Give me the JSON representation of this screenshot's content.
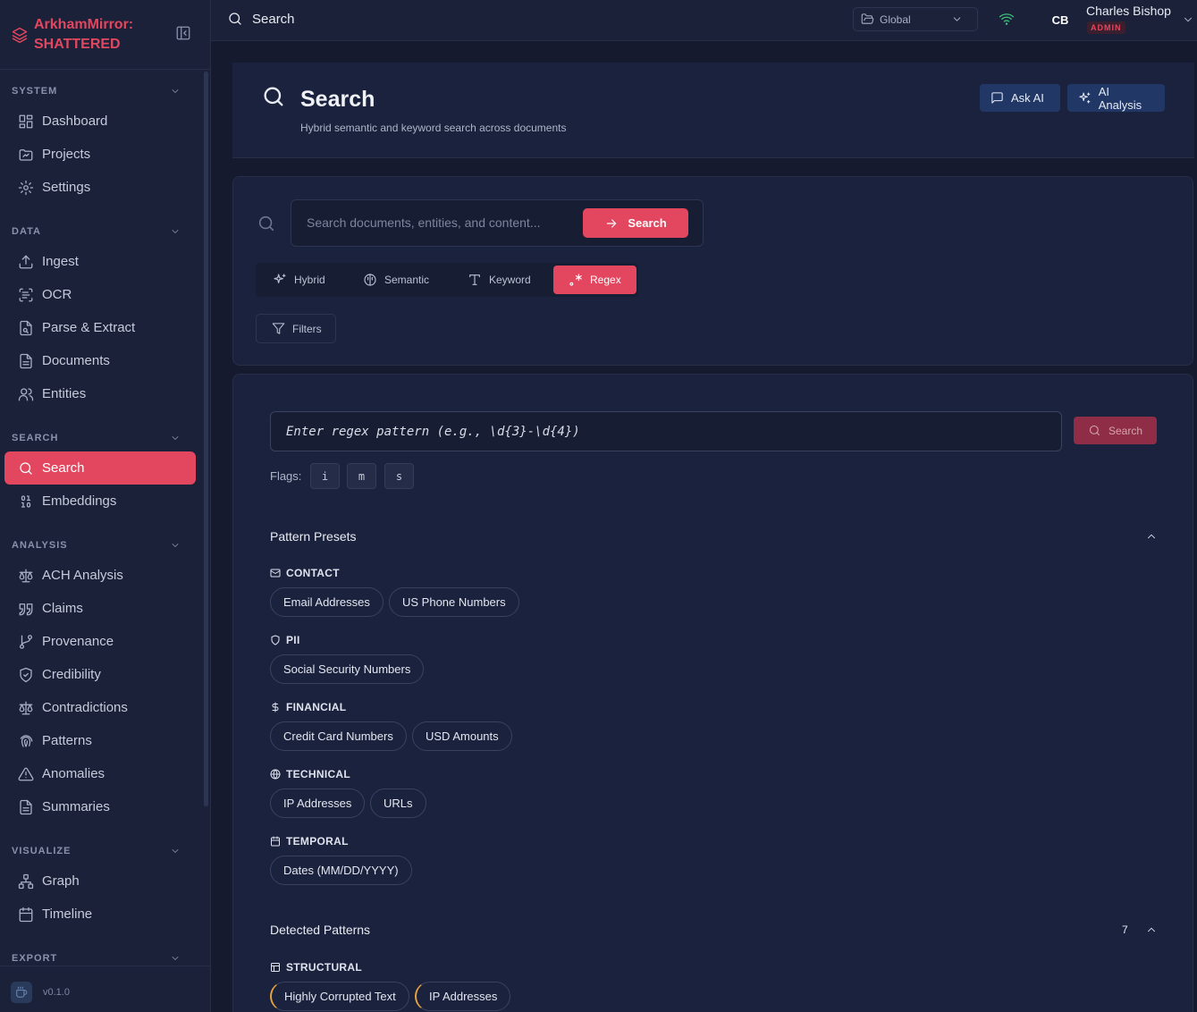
{
  "app": {
    "name": "ArkhamMirror: SHATTERED",
    "version": "v0.1.0"
  },
  "sidebar": {
    "sections": [
      {
        "title": "SYSTEM",
        "items": [
          "Dashboard",
          "Projects",
          "Settings"
        ]
      },
      {
        "title": "DATA",
        "items": [
          "Ingest",
          "OCR",
          "Parse & Extract",
          "Documents",
          "Entities"
        ]
      },
      {
        "title": "SEARCH",
        "items": [
          "Search",
          "Embeddings"
        ]
      },
      {
        "title": "ANALYSIS",
        "items": [
          "ACH Analysis",
          "Claims",
          "Provenance",
          "Credibility",
          "Contradictions",
          "Patterns",
          "Anomalies",
          "Summaries"
        ]
      },
      {
        "title": "VISUALIZE",
        "items": [
          "Graph",
          "Timeline"
        ]
      },
      {
        "title": "EXPORT",
        "items": []
      }
    ],
    "active_item": "Search"
  },
  "topbar": {
    "title": "Search",
    "workspace": "Global",
    "user": {
      "initials": "CB",
      "name": "Charles Bishop",
      "role": "ADMIN"
    },
    "status_color": "#3ec47a"
  },
  "header": {
    "title": "Search",
    "subtitle": "Hybrid semantic and keyword search across documents",
    "ask_ai": "Ask AI",
    "ai_analysis": "AI Analysis"
  },
  "search": {
    "placeholder": "Search documents, entities, and content...",
    "button": "Search",
    "modes": [
      "Hybrid",
      "Semantic",
      "Keyword",
      "Regex"
    ],
    "active_mode": "Regex",
    "filters": "Filters"
  },
  "regex": {
    "placeholder": "Enter regex pattern (e.g., \\d{3}-\\d{4})",
    "button": "Search",
    "flags_label": "Flags:",
    "flags": [
      "i",
      "m",
      "s"
    ]
  },
  "presets": {
    "title": "Pattern Presets",
    "groups": [
      {
        "name": "CONTACT",
        "icon": "mail-icon",
        "items": [
          "Email Addresses",
          "US Phone Numbers"
        ]
      },
      {
        "name": "PII",
        "icon": "shield-icon",
        "items": [
          "Social Security Numbers"
        ]
      },
      {
        "name": "FINANCIAL",
        "icon": "dollar-icon",
        "items": [
          "Credit Card Numbers",
          "USD Amounts"
        ]
      },
      {
        "name": "TECHNICAL",
        "icon": "globe-icon",
        "items": [
          "IP Addresses",
          "URLs"
        ]
      },
      {
        "name": "TEMPORAL",
        "icon": "calendar-icon",
        "items": [
          "Dates (MM/DD/YYYY)"
        ]
      }
    ]
  },
  "detected": {
    "title": "Detected Patterns",
    "count": "7",
    "groups": [
      {
        "name": "STRUCTURAL",
        "icon": "table-icon",
        "items": [
          "Highly Corrupted Text",
          "IP Addresses"
        ]
      }
    ]
  },
  "colors": {
    "accent": "#e3475f",
    "warning": "#e8a43a",
    "bg": "#161a2e"
  }
}
